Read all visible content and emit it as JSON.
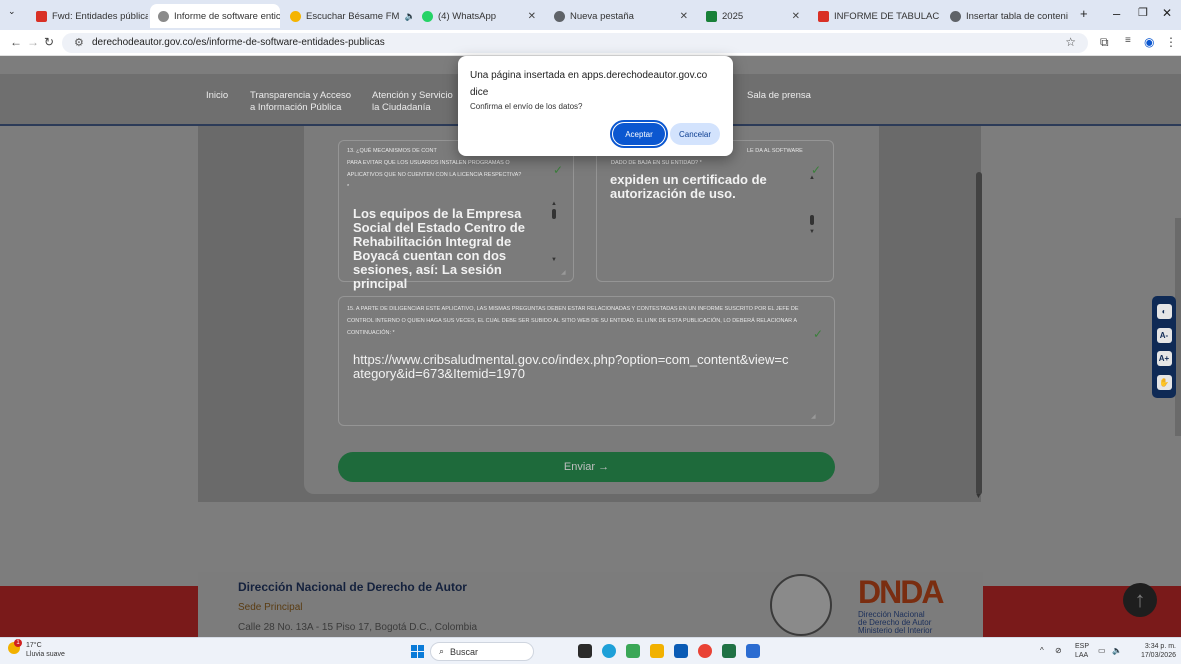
{
  "browser": {
    "tabs": [
      {
        "label": "Fwd: Entidades públicas d",
        "icon": "gmail-icon",
        "color": "#d93025"
      },
      {
        "label": "Informe de software entic",
        "icon": "site-icon",
        "color": "#7a7a7a"
      },
      {
        "label": "Escuchar Bésame FM",
        "icon": "radio-icon",
        "color": "#f5b400"
      },
      {
        "label": "(4) WhatsApp",
        "icon": "whatsapp-icon",
        "color": "#25d366"
      },
      {
        "label": "Nueva pestaña",
        "icon": "globe-icon",
        "color": "#5f6368"
      },
      {
        "label": "2025",
        "icon": "sheets-icon",
        "color": "#188038"
      },
      {
        "label": "INFORME DE TABULACIÓ",
        "icon": "pdf-icon",
        "color": "#d93025"
      },
      {
        "label": "Insertar tabla de conteni",
        "icon": "site-icon",
        "color": "#5f6368"
      }
    ],
    "new_tab": "+",
    "url": "derechodeautor.gov.co/es/informe-de-software-entidades-publicas"
  },
  "nav": {
    "items": [
      {
        "line1": "Inicio",
        "line2": ""
      },
      {
        "line1": "Transparencia y Acceso",
        "line2": "a Información Pública"
      },
      {
        "line1": "Atención y Servicio",
        "line2": "la Ciudadanía"
      },
      {
        "line1": "Sala de prensa",
        "line2": ""
      }
    ]
  },
  "form": {
    "q13_label": "13. ¿QUÉ MECANISMOS DE CONTROL SE HAN IMPLEMENTADO PARA EVITAR QUE LOS USUARIOS INSTALEN PROGRAMAS O APLICATIVOS QUE NO CUENTEN CON LA LICENCIA RESPECTIVA? *",
    "q13_label_l1": "13. ¿QUÉ MECANISMOS DE CONT",
    "q13_label_l2": "PARA EVITAR QUE LOS USUARIOS INSTALEN PROGRAMAS O",
    "q13_label_l3": "APLICATIVOS QUE NO CUENTEN CON LA LICENCIA RESPECTIVA?",
    "q13_label_l4": "*",
    "q13_answer": "Los equipos de la Empresa Social del Estado Centro de Rehabilitación Integral de Boyacá cuentan con dos sesiones, así: La sesión principal",
    "q14_label_l1": "LE DA AL SOFTWARE",
    "q14_label_l2": "DADO DE BAJA EN SU ENTIDAD? *",
    "q14_answer": "expiden un certificado de autorización de uso.",
    "q15_label": "15. A PARTE DE DILIGENCIAR ESTE APLICATIVO, LAS MISMAS PREGUNTAS DEBEN ESTAR RELACIONADAS Y CONTESTADAS EN UN INFORME SUSCRITO POR EL JEFE DE CONTROL INTERNO O QUIEN HAGA SUS VECES, EL CUAL DEBE SER SUBIDO AL SITIO WEB DE SU ENTIDAD. EL LINK DE ESTA PUBLICACIÓN, LO DEBERÁ RELACIONAR A CONTINUACIÓN: *",
    "q15_answer": "https://www.cribsaludmental.gov.co/index.php?option=com_content&view=category&id=673&Itemid=1970",
    "submit_label": "Enviar  →"
  },
  "footer": {
    "title": "Dirección Nacional de Derecho de Autor",
    "sede": "Sede Principal",
    "address": "Calle 28 No. 13A - 15 Piso 17, Bogotá D.C., Colombia",
    "logo_text": "DNDA",
    "logo_sub1": "Dirección Nacional",
    "logo_sub2": "de Derecho de Autor",
    "logo_sub3": "Ministerio del Interior"
  },
  "dialog": {
    "title": "Una página insertada en apps.derechodeautor.gov.co dice",
    "message": "Confirma el envío de los datos?",
    "ok": "Aceptar",
    "cancel": "Cancelar"
  },
  "taskbar": {
    "temp": "17°C",
    "weather": "Lluvia suave",
    "weather_badge": "1",
    "search": "Buscar",
    "lang1": "ESP",
    "lang2": "LAA",
    "time": "3:34 p. m.",
    "date": "17/03/2026"
  }
}
